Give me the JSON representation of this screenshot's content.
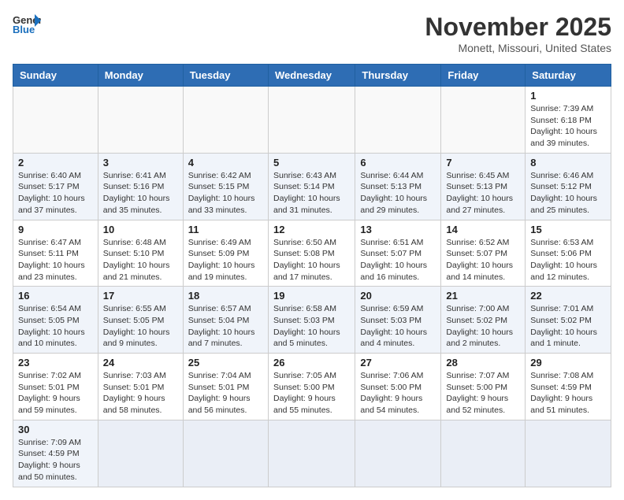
{
  "logo": {
    "text_general": "General",
    "text_blue": "Blue"
  },
  "title": "November 2025",
  "location": "Monett, Missouri, United States",
  "weekdays": [
    "Sunday",
    "Monday",
    "Tuesday",
    "Wednesday",
    "Thursday",
    "Friday",
    "Saturday"
  ],
  "weeks": [
    [
      {
        "day": "",
        "info": ""
      },
      {
        "day": "",
        "info": ""
      },
      {
        "day": "",
        "info": ""
      },
      {
        "day": "",
        "info": ""
      },
      {
        "day": "",
        "info": ""
      },
      {
        "day": "",
        "info": ""
      },
      {
        "day": "1",
        "info": "Sunrise: 7:39 AM\nSunset: 6:18 PM\nDaylight: 10 hours and 39 minutes."
      }
    ],
    [
      {
        "day": "2",
        "info": "Sunrise: 6:40 AM\nSunset: 5:17 PM\nDaylight: 10 hours and 37 minutes."
      },
      {
        "day": "3",
        "info": "Sunrise: 6:41 AM\nSunset: 5:16 PM\nDaylight: 10 hours and 35 minutes."
      },
      {
        "day": "4",
        "info": "Sunrise: 6:42 AM\nSunset: 5:15 PM\nDaylight: 10 hours and 33 minutes."
      },
      {
        "day": "5",
        "info": "Sunrise: 6:43 AM\nSunset: 5:14 PM\nDaylight: 10 hours and 31 minutes."
      },
      {
        "day": "6",
        "info": "Sunrise: 6:44 AM\nSunset: 5:13 PM\nDaylight: 10 hours and 29 minutes."
      },
      {
        "day": "7",
        "info": "Sunrise: 6:45 AM\nSunset: 5:13 PM\nDaylight: 10 hours and 27 minutes."
      },
      {
        "day": "8",
        "info": "Sunrise: 6:46 AM\nSunset: 5:12 PM\nDaylight: 10 hours and 25 minutes."
      }
    ],
    [
      {
        "day": "9",
        "info": "Sunrise: 6:47 AM\nSunset: 5:11 PM\nDaylight: 10 hours and 23 minutes."
      },
      {
        "day": "10",
        "info": "Sunrise: 6:48 AM\nSunset: 5:10 PM\nDaylight: 10 hours and 21 minutes."
      },
      {
        "day": "11",
        "info": "Sunrise: 6:49 AM\nSunset: 5:09 PM\nDaylight: 10 hours and 19 minutes."
      },
      {
        "day": "12",
        "info": "Sunrise: 6:50 AM\nSunset: 5:08 PM\nDaylight: 10 hours and 17 minutes."
      },
      {
        "day": "13",
        "info": "Sunrise: 6:51 AM\nSunset: 5:07 PM\nDaylight: 10 hours and 16 minutes."
      },
      {
        "day": "14",
        "info": "Sunrise: 6:52 AM\nSunset: 5:07 PM\nDaylight: 10 hours and 14 minutes."
      },
      {
        "day": "15",
        "info": "Sunrise: 6:53 AM\nSunset: 5:06 PM\nDaylight: 10 hours and 12 minutes."
      }
    ],
    [
      {
        "day": "16",
        "info": "Sunrise: 6:54 AM\nSunset: 5:05 PM\nDaylight: 10 hours and 10 minutes."
      },
      {
        "day": "17",
        "info": "Sunrise: 6:55 AM\nSunset: 5:05 PM\nDaylight: 10 hours and 9 minutes."
      },
      {
        "day": "18",
        "info": "Sunrise: 6:57 AM\nSunset: 5:04 PM\nDaylight: 10 hours and 7 minutes."
      },
      {
        "day": "19",
        "info": "Sunrise: 6:58 AM\nSunset: 5:03 PM\nDaylight: 10 hours and 5 minutes."
      },
      {
        "day": "20",
        "info": "Sunrise: 6:59 AM\nSunset: 5:03 PM\nDaylight: 10 hours and 4 minutes."
      },
      {
        "day": "21",
        "info": "Sunrise: 7:00 AM\nSunset: 5:02 PM\nDaylight: 10 hours and 2 minutes."
      },
      {
        "day": "22",
        "info": "Sunrise: 7:01 AM\nSunset: 5:02 PM\nDaylight: 10 hours and 1 minute."
      }
    ],
    [
      {
        "day": "23",
        "info": "Sunrise: 7:02 AM\nSunset: 5:01 PM\nDaylight: 9 hours and 59 minutes."
      },
      {
        "day": "24",
        "info": "Sunrise: 7:03 AM\nSunset: 5:01 PM\nDaylight: 9 hours and 58 minutes."
      },
      {
        "day": "25",
        "info": "Sunrise: 7:04 AM\nSunset: 5:01 PM\nDaylight: 9 hours and 56 minutes."
      },
      {
        "day": "26",
        "info": "Sunrise: 7:05 AM\nSunset: 5:00 PM\nDaylight: 9 hours and 55 minutes."
      },
      {
        "day": "27",
        "info": "Sunrise: 7:06 AM\nSunset: 5:00 PM\nDaylight: 9 hours and 54 minutes."
      },
      {
        "day": "28",
        "info": "Sunrise: 7:07 AM\nSunset: 5:00 PM\nDaylight: 9 hours and 52 minutes."
      },
      {
        "day": "29",
        "info": "Sunrise: 7:08 AM\nSunset: 4:59 PM\nDaylight: 9 hours and 51 minutes."
      }
    ],
    [
      {
        "day": "30",
        "info": "Sunrise: 7:09 AM\nSunset: 4:59 PM\nDaylight: 9 hours and 50 minutes."
      },
      {
        "day": "",
        "info": ""
      },
      {
        "day": "",
        "info": ""
      },
      {
        "day": "",
        "info": ""
      },
      {
        "day": "",
        "info": ""
      },
      {
        "day": "",
        "info": ""
      },
      {
        "day": "",
        "info": ""
      }
    ]
  ]
}
